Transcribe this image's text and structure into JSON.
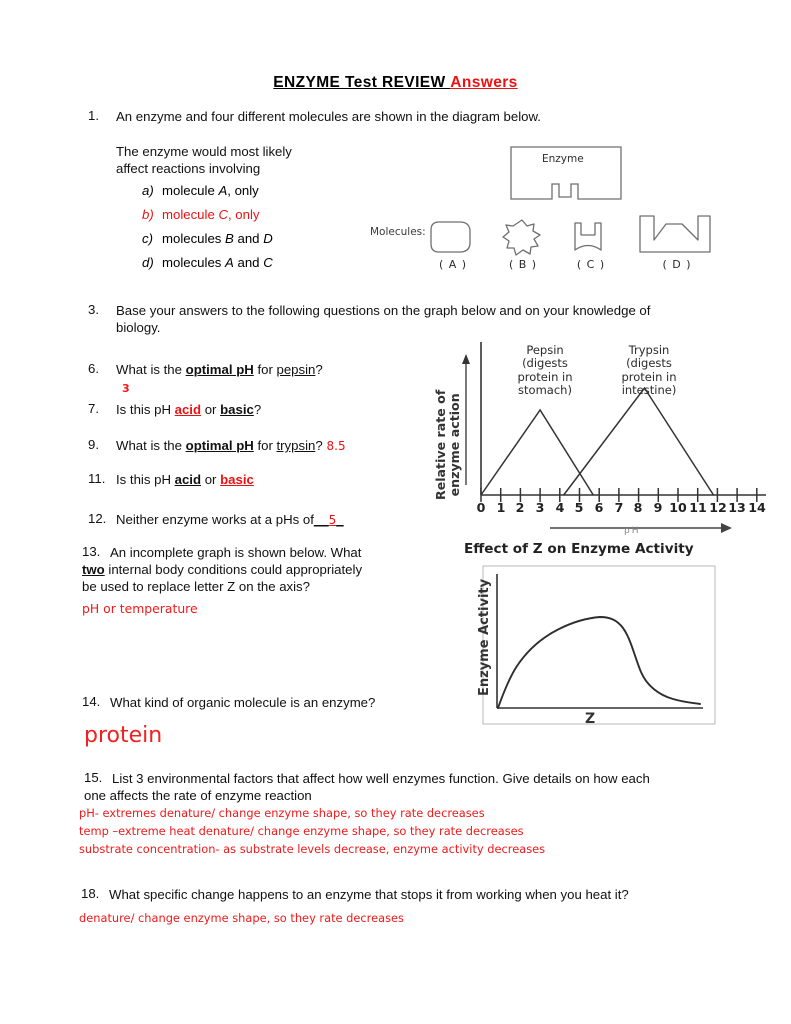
{
  "document": {
    "title_main": "ENZYME Test REVIEW",
    "title_answers": "Answers"
  },
  "q1": {
    "number": "1.",
    "stem": "An enzyme and four different molecules are shown in the diagram below.",
    "lead_line1": "The enzyme would most likely",
    "lead_line2": "affect reactions involving",
    "choices": [
      {
        "label": "a)",
        "text": "molecule A, only",
        "is_answer": false
      },
      {
        "label": "b)",
        "text": "molecule C, only",
        "is_answer": true
      },
      {
        "label": "c)",
        "text": "molecules B and D",
        "is_answer": false
      },
      {
        "label": "d)",
        "text": "molecules A and C",
        "is_answer": false
      }
    ]
  },
  "diagram": {
    "enzyme_label": "Enzyme",
    "molecules_label": "Molecules:",
    "captions": [
      "( A )",
      "( B )",
      "( C )",
      "( D )"
    ]
  },
  "q3": {
    "number": "3.",
    "line1": "Base your answers to the following questions on the graph below and on your knowledge of",
    "line2": "biology."
  },
  "q6": {
    "number": "6.",
    "text_a": "What is the ",
    "text_bold": "optimal pH",
    "text_b": " for ",
    "text_underline": "pepsin",
    "text_c": "?",
    "answer": "3"
  },
  "q7": {
    "number": "7.",
    "text_a": "Is this pH ",
    "opt1": "acid",
    "text_b": " or ",
    "opt2": "basic",
    "text_c": "?",
    "answer_is": "acid"
  },
  "q9": {
    "number": "9.",
    "text_a": "What is the ",
    "text_bold": "optimal pH",
    "text_b": " for ",
    "text_underline": "trypsin",
    "text_c": "?",
    "answer": "8.5"
  },
  "q11": {
    "number": "11.",
    "text_a": "Is this pH ",
    "opt1": "acid",
    "text_b": " or ",
    "opt2": "basic",
    "answer_is": "basic"
  },
  "q12": {
    "number": "12.",
    "text": "Neither enzyme works at a pHs of",
    "blank_prefix": "__",
    "answer": "5",
    "blank_suffix": "_"
  },
  "q13": {
    "number": "13.",
    "line1_a": "An incomplete graph is shown below. What",
    "line2_bold": "two",
    "line2_rest": " internal body conditions could appropriately",
    "line3": "be used to replace letter Z on the axis?",
    "answer": "pH or temperature"
  },
  "q14": {
    "number": "14.",
    "text": "What kind of organic molecule is an enzyme?",
    "answer": "protein"
  },
  "q15": {
    "number": "15.",
    "line1": "List 3 environmental factors that affect how well enzymes function. Give details on how each",
    "line2": "one affects the rate of enzyme reaction",
    "answers": [
      "pH- extremes denature/ change enzyme shape, so they rate decreases",
      "temp –extreme heat  denature/ change enzyme shape, so they rate decreases",
      "substrate concentration- as substrate levels decrease, enzyme activity decreases"
    ]
  },
  "q18": {
    "number": "18.",
    "text": "What specific change happens to an enzyme that stops it from working when you heat it?",
    "answer": "denature/ change enzyme shape, so they rate decreases"
  },
  "chart_data": [
    {
      "type": "line",
      "title": "",
      "xlabel": "pH",
      "ylabel": "Relative rate of enzyme action",
      "xlim": [
        0,
        14
      ],
      "ylim": [
        0,
        1
      ],
      "grid": false,
      "legend": "annotations",
      "xticks": [
        "0",
        "1",
        "2",
        "3",
        "4",
        "5",
        "6",
        "7",
        "8",
        "9",
        "10",
        "11",
        "12",
        "13",
        "14"
      ],
      "annotations": [
        {
          "text": "Pepsin\n(digests\nprotein in\nstomach)",
          "x": 3
        },
        {
          "text": "Trypsin\n(digests\nprotein in\nintestine)",
          "x": 8.3
        }
      ],
      "series": [
        {
          "name": "Pepsin",
          "x": [
            0,
            3,
            5.7
          ],
          "y": [
            0,
            0.62,
            0
          ]
        },
        {
          "name": "Trypsin",
          "x": [
            4.2,
            8.3,
            11.8
          ],
          "y": [
            0,
            0.78,
            0
          ]
        }
      ]
    },
    {
      "type": "line",
      "title": "Effect of Z on Enzyme Activity",
      "xlabel": "Z",
      "ylabel": "Enzyme Activity",
      "grid": false,
      "xticks": [],
      "yticks": [],
      "series": [
        {
          "name": "Enzyme Activity vs Z",
          "x": [
            0,
            0.06,
            0.14,
            0.25,
            0.38,
            0.5,
            0.58,
            0.66,
            0.74,
            0.8,
            0.88,
            1.0
          ],
          "y": [
            0,
            0.33,
            0.52,
            0.68,
            0.79,
            0.83,
            0.82,
            0.72,
            0.46,
            0.28,
            0.18,
            0.12
          ]
        }
      ]
    }
  ]
}
